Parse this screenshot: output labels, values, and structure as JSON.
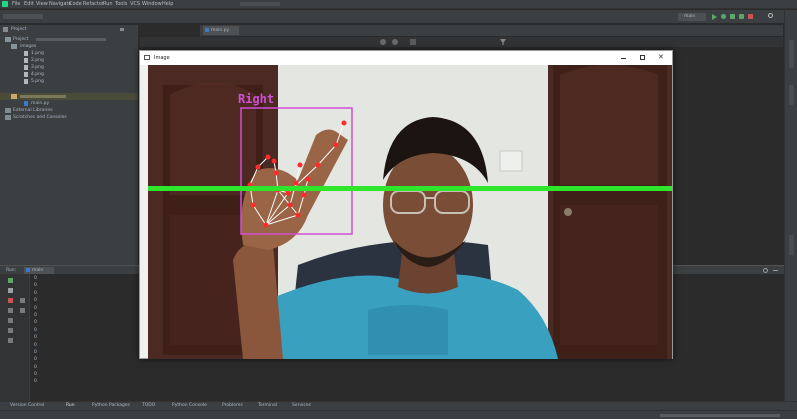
{
  "menu": [
    "File",
    "Edit",
    "View",
    "Navigate",
    "Code",
    "Refactor",
    "Run",
    "Tools",
    "VCS",
    "Window",
    "Help"
  ],
  "project_panel": {
    "title": "Project",
    "rows": [
      {
        "label": "Project",
        "indent": 0
      },
      {
        "label": "images",
        "indent": 1
      },
      {
        "label": "1.png",
        "indent": 2
      },
      {
        "label": "2.png",
        "indent": 2
      },
      {
        "label": "3.png",
        "indent": 2
      },
      {
        "label": "4.png",
        "indent": 2
      },
      {
        "label": "5.png",
        "indent": 2
      },
      {
        "label": "",
        "indent": 1,
        "selected": true
      },
      {
        "label": "main.py",
        "indent": 2
      },
      {
        "label": "External Libraries",
        "indent": 0
      },
      {
        "label": "Scratches and Consoles",
        "indent": 0
      }
    ]
  },
  "editor_tab": "main.py",
  "run_panel": {
    "label": "Run:",
    "config": "main",
    "line_numbers": [
      "0",
      "0",
      "0",
      "0",
      "0",
      "0",
      "0",
      "0",
      "0",
      "0",
      "0",
      "0",
      "0",
      "0",
      "0"
    ]
  },
  "cv_window": {
    "title": "Image",
    "hand_label": "Right"
  },
  "bottom_tabs": [
    "Version Control",
    "Run",
    "Python Packages",
    "TODO",
    "Python Console",
    "Problems",
    "Terminal",
    "Services"
  ],
  "run_config": "main",
  "colors": {
    "ide_bg": "#2b2b2b",
    "panel_bg": "#3c3f41",
    "bbox": "#d24fd6",
    "line": "#2ee62a",
    "landmark_point": "#ff2a2a",
    "landmark_line": "#ffffff"
  }
}
